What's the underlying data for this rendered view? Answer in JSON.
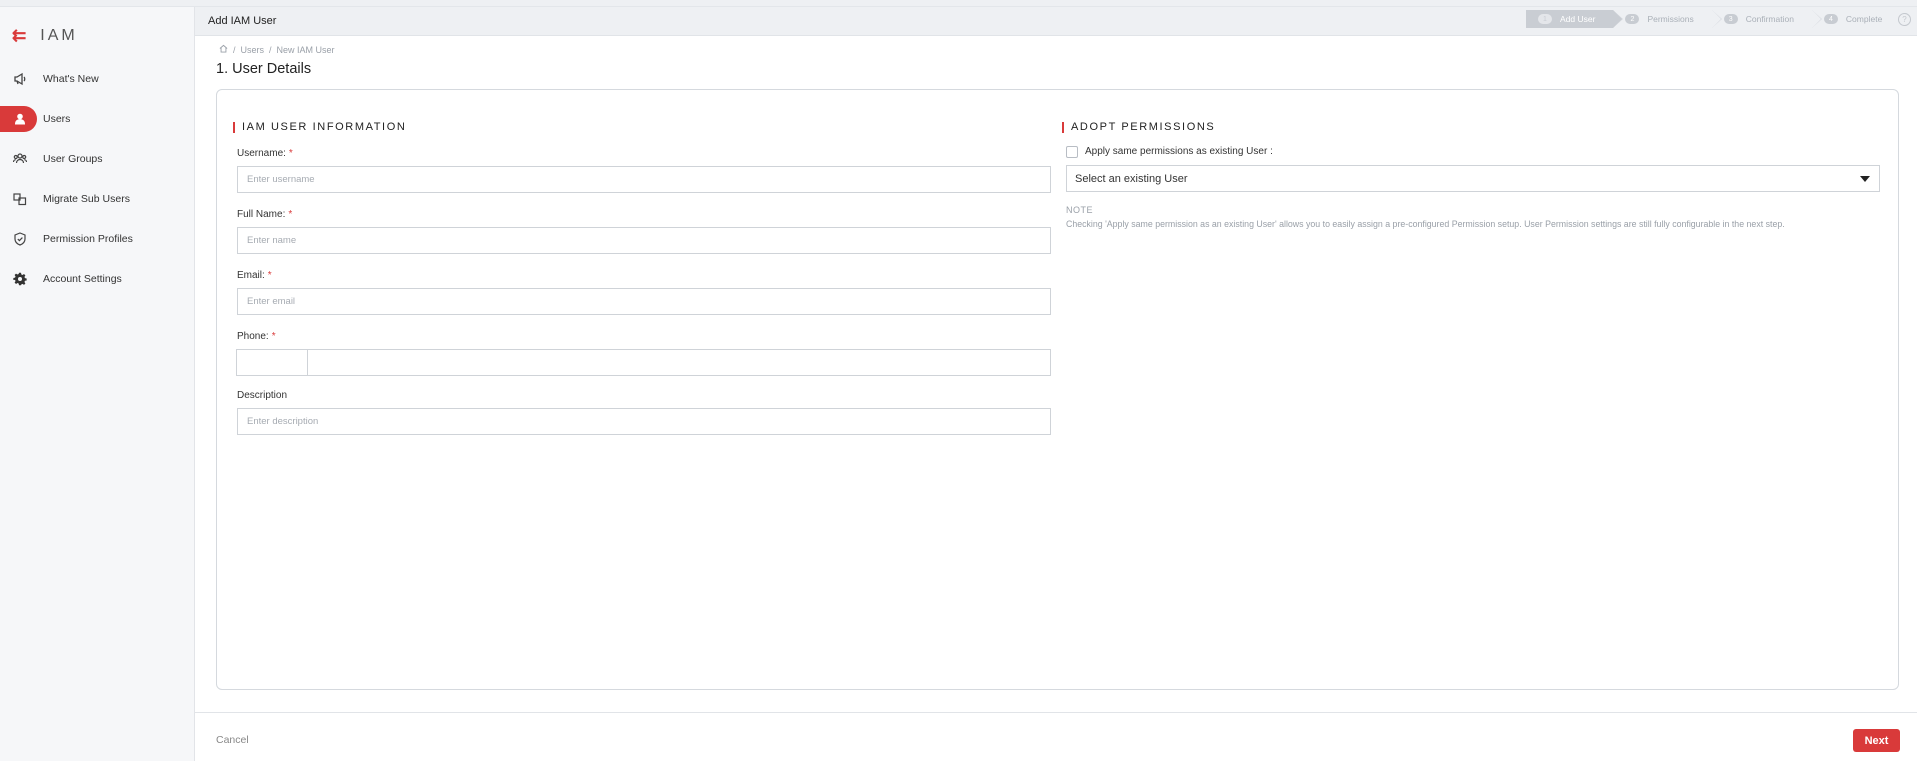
{
  "brand": {
    "title": "IAM",
    "collapse_icon": "collapse-menu-icon"
  },
  "sidebar": {
    "items": [
      {
        "label": "What's New",
        "icon": "megaphone-icon",
        "active": false
      },
      {
        "label": "Users",
        "icon": "user-icon",
        "active": true
      },
      {
        "label": "User Groups",
        "icon": "user-group-icon",
        "active": false
      },
      {
        "label": "Migrate Sub Users",
        "icon": "migrate-icon",
        "active": false
      },
      {
        "label": "Permission Profiles",
        "icon": "shield-check-icon",
        "active": false
      },
      {
        "label": "Account Settings",
        "icon": "gear-icon",
        "active": false
      }
    ]
  },
  "header": {
    "title": "Add IAM User",
    "help_icon": "help-icon",
    "steps": [
      {
        "num": "1",
        "label": "Add User",
        "active": true
      },
      {
        "num": "2",
        "label": "Permissions",
        "active": false
      },
      {
        "num": "3",
        "label": "Confirmation",
        "active": false
      },
      {
        "num": "4",
        "label": "Complete",
        "active": false
      }
    ]
  },
  "breadcrumb": {
    "home_icon": "home-icon",
    "sep": "/",
    "items": [
      "Users",
      "New IAM User"
    ]
  },
  "page": {
    "title": "1. User Details"
  },
  "user_info": {
    "section_title": "IAM USER INFORMATION",
    "required_mark": "*",
    "username": {
      "label": "Username:",
      "placeholder": "Enter username",
      "value": ""
    },
    "fullname": {
      "label": "Full Name:",
      "placeholder": "Enter name",
      "value": ""
    },
    "email": {
      "label": "Email:",
      "placeholder": "Enter email",
      "value": ""
    },
    "phone": {
      "label": "Phone:",
      "code": "",
      "value": ""
    },
    "description": {
      "label": "Description",
      "placeholder": "Enter description",
      "value": ""
    }
  },
  "permissions": {
    "section_title": "ADOPT PERMISSIONS",
    "checkbox_label": "Apply same permissions as existing User :",
    "checked": false,
    "select_value": "Select an existing User",
    "note_title": "NOTE",
    "note_text": "Checking 'Apply same permission as an existing User' allows you to easily assign a pre-configured Permission setup. User Permission settings are still fully configurable in the next step."
  },
  "footer": {
    "cancel_label": "Cancel",
    "next_label": "Next"
  },
  "colors": {
    "accent": "#d93a3a",
    "muted": "#9aa0a8",
    "border": "#cfd3d8"
  }
}
